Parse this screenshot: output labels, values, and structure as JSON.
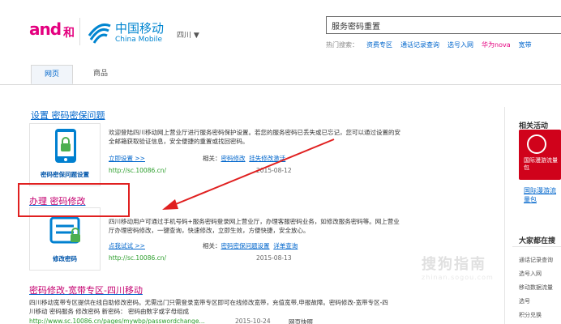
{
  "header": {
    "logo_and": "and",
    "logo_he": "和",
    "brand_name": "中国移动",
    "brand_en": "China Mobile",
    "province": "四川 ▼",
    "search_value": "服务密码重置",
    "hot_label": "热门搜索：",
    "hot_links": [
      "资费专区",
      "通话记录查询",
      "选号入网",
      "华为nova",
      "宽带"
    ]
  },
  "tabs": [
    "网页",
    "商品"
  ],
  "results": [
    {
      "title": "设置 密码密保问题",
      "thumb_caption": "密码密保问题设置",
      "snippet": "欢迎登陆四川移动网上营业厅进行服务密码保护设置。若您的服务密码已丢失或已忘记，您可以通过设置的安全邮箱获取验证信息，安全便捷的重置或找回密码。",
      "action": "立即设置 >>",
      "related_label": "相关：",
      "related": [
        "密码修改",
        "挂失修改激活"
      ],
      "url": "http://sc.10086.cn/",
      "date": "2015-08-12"
    },
    {
      "title": "办理 密码修改",
      "thumb_caption": "修改密码",
      "snippet": "四川移动用户可通过手机号码+服务密码登录网上营业厅，办理客服密码业务，如修改服务密码等。网上营业厅办理密码修改，一键查询，快速修改，立即生效，方便快捷，安全放心。",
      "action": "点我试试 >>",
      "related_label": "相关：",
      "related": [
        "密码密保问题设置",
        "详单查询"
      ],
      "url": "http://sc.10086.cn/",
      "date": "2015-08-13"
    },
    {
      "title": "密码修改-宽带专区-四川移动",
      "snippet": "四川移动宽带专区提供在线自助修改密码。无需出门只需登录宽带专区即可在线修改宽带，充值宽带,申报故障。密码修改-宽带专区-四川移动  密码服务 修改密码  新密码：  密码由数字或字母组成",
      "url": "http://www.sc.10086.cn/pages/mywbp/passwordchange...",
      "date": "2015-10-24",
      "extra": "网页快照"
    }
  ],
  "sidebar": {
    "activity_title": "相关活动",
    "banner_text": "国际漫游流量包",
    "banner_link": "国际漫游流量包",
    "search_title": "大家都在搜",
    "items": [
      "通话记录查询",
      "选号入网",
      "移动数据流量",
      "选号",
      "积分兑换"
    ]
  },
  "watermark": {
    "title": "搜狗指南",
    "sub": "zhinan.sogou.com"
  },
  "colors": {
    "brand_blue": "#0085d0",
    "brand_pink": "#e4007f",
    "link": "#0066cc",
    "url_green": "#2a9d2a",
    "highlight": "#e02020"
  }
}
